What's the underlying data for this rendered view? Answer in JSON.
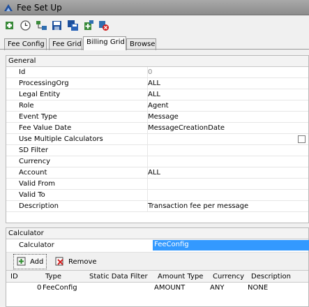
{
  "window": {
    "title": "Fee Set Up"
  },
  "toolbar": {
    "icons": [
      "add-icon",
      "clock-icon",
      "tree-icon",
      "save-icon",
      "save-all-icon",
      "new-icon",
      "delete-icon"
    ]
  },
  "tabs": [
    {
      "label": "Fee Config"
    },
    {
      "label": "Fee Grid"
    },
    {
      "label": "Billing Grid",
      "active": true
    },
    {
      "label": "Browse"
    }
  ],
  "general": {
    "header": "General",
    "rows": [
      {
        "label": "Id",
        "value": "0"
      },
      {
        "label": "ProcessingOrg",
        "value": "ALL"
      },
      {
        "label": "Legal Entity",
        "value": "ALL"
      },
      {
        "label": "Role",
        "value": "Agent"
      },
      {
        "label": "Event Type",
        "value": "Message"
      },
      {
        "label": "Fee Value Date",
        "value": "MessageCreationDate"
      },
      {
        "label": "Use Multiple Calculators",
        "value": ""
      },
      {
        "label": "SD Filter",
        "value": ""
      },
      {
        "label": "Currency",
        "value": ""
      },
      {
        "label": "Account",
        "value": "ALL"
      },
      {
        "label": "Valid From",
        "value": ""
      },
      {
        "label": "Valid To",
        "value": ""
      },
      {
        "label": "Description",
        "value": "Transaction fee per message"
      }
    ]
  },
  "calculator": {
    "header": "Calculator",
    "label": "Calculator",
    "value": "FeeConfig",
    "add_label": "Add",
    "remove_label": "Remove",
    "columns": [
      "ID",
      "Type",
      "Static Data Filter",
      "Amount Type",
      "Currency",
      "Description"
    ],
    "rows": [
      {
        "id": "0",
        "type": "FeeConfig",
        "filter": "",
        "amount_type": "AMOUNT",
        "currency": "ANY",
        "description": "NONE"
      }
    ]
  },
  "colors": {
    "selection": "#3399ff",
    "titlebar": "#9a9a9a"
  }
}
